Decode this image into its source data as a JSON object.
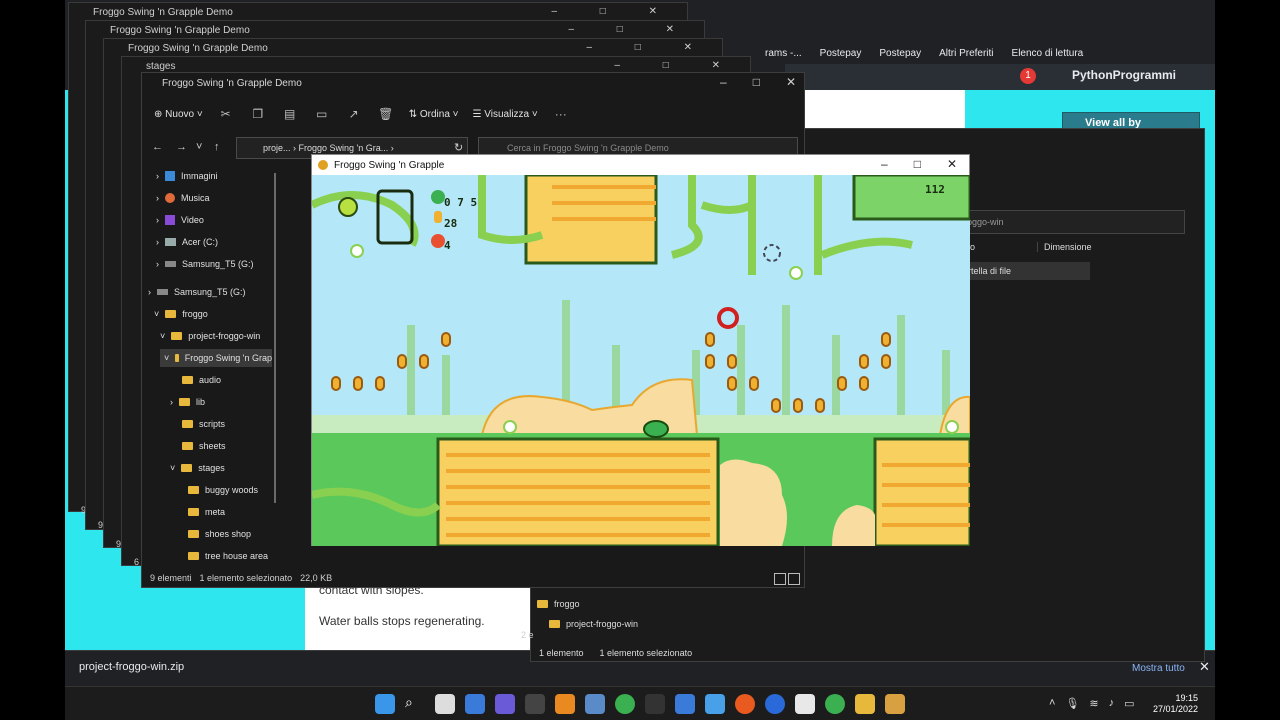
{
  "browser": {
    "bookmarks": [
      "rams -...",
      "Postepay",
      "Postepay",
      "Altri Preferiti",
      "Elenco di lettura"
    ],
    "site_user": "PythonProgrammi",
    "notification_count": "1",
    "smelly_button": "View all by SmellyFrog",
    "page_text_1": "contact with slopes.",
    "page_text_2": "Water balls stops regenerating.",
    "download_file": "project-froggo-win.zip",
    "show_all": "Mostra tutto"
  },
  "stack_windows": [
    {
      "title": "Froggo Swing 'n Grapple Demo"
    },
    {
      "title": "Froggo Swing 'n Grapple Demo"
    },
    {
      "title": "Froggo Swing 'n Grapple Demo"
    },
    {
      "title": "stages"
    }
  ],
  "stack_counts": [
    "9 e",
    "9 e",
    "9 e",
    "6 e"
  ],
  "explorer": {
    "title": "Froggo Swing 'n Grapple Demo",
    "new_label": "Nuovo",
    "sort_label": "Ordina",
    "view_label": "Visualizza",
    "address_seg1": "proje...",
    "address_seg2": "Froggo Swing 'n Gra...",
    "search_placeholder": "Cerca in Froggo Swing 'n Grapple Demo",
    "tree": [
      "Immagini",
      "Musica",
      "Video",
      "Acer (C:)",
      "Samsung_T5 (G:)",
      "Samsung_T5 (G:)",
      "froggo",
      "project-froggo-win",
      "Froggo Swing 'n Grap",
      "audio",
      "lib",
      "scripts",
      "sheets",
      "stages",
      "buggy woods",
      "meta",
      "shoes shop",
      "tree house area"
    ],
    "status_items": "9 elementi",
    "status_selected": "1 elemento selezionato",
    "status_size": "22,0 KB"
  },
  "explorer2": {
    "search_text": "oggo-win",
    "col_type": "po",
    "col_size": "Dimensione",
    "row_type": "artella di file",
    "tree_froggo": "froggo",
    "tree_project": "project-froggo-win",
    "status_items": "1 elemento",
    "status_selected": "1 elemento selezionato",
    "side_count": "2 e"
  },
  "game": {
    "title": "Froggo Swing 'n Grapple",
    "lives": "0 7 5",
    "coins": "28",
    "keys": "4",
    "time": "112"
  },
  "taskbar": {
    "time": "19:15",
    "date": "27/01/2022"
  }
}
